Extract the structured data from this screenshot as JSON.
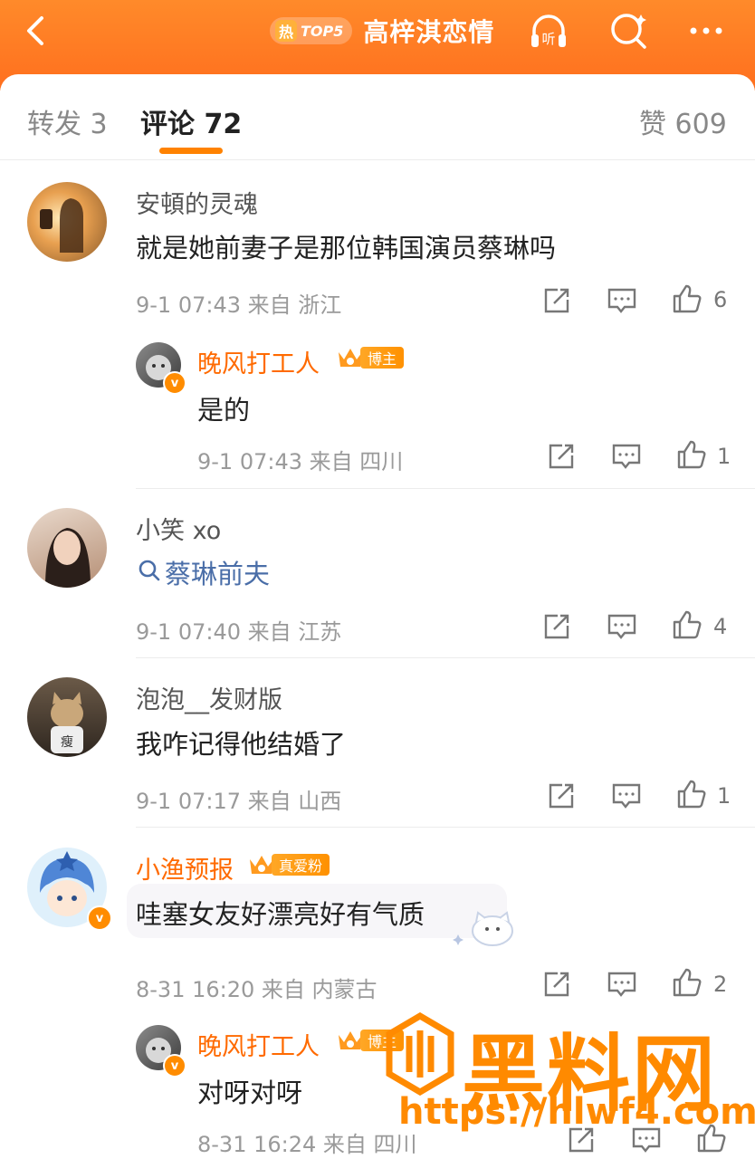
{
  "header": {
    "hot_char": "热",
    "hot_rank": "TOP5",
    "title": "高梓淇恋情",
    "listen_label": "听"
  },
  "tabs": {
    "repost": "转发 3",
    "comments": "评论 72",
    "likes": "赞 609"
  },
  "comments": [
    {
      "user": "安頓的灵魂",
      "text": "就是她前妻子是那位韩国演员蔡琳吗",
      "meta": "9-1 07:43  来自 浙江",
      "likes": "6",
      "reply": {
        "user": "晚风打工人",
        "badge": "博主",
        "text": "是的",
        "meta": "9-1 07:43  来自 四川",
        "likes": "1"
      }
    },
    {
      "user": "小笑 xo",
      "search_text": "蔡琳前夫",
      "meta": "9-1 07:40  来自 江苏",
      "likes": "4"
    },
    {
      "user": "泡泡__发财版",
      "text": "我咋记得他结婚了",
      "meta": "9-1 07:17  来自 山西",
      "likes": "1"
    },
    {
      "user": "小渔预报",
      "badge": "真爱粉",
      "text": "哇塞女友好漂亮好有气质",
      "meta": "8-31 16:20  来自 内蒙古",
      "likes": "2",
      "reply": {
        "user": "晚风打工人",
        "badge": "博主",
        "text": "对呀对呀",
        "meta": "8-31 16:24  来自 四川"
      }
    }
  ],
  "watermark": {
    "text": "黑料网",
    "url": "https://hlwf4.com"
  },
  "colors": {
    "header": "#ff7a22",
    "accent": "#ff8200",
    "link": "#4a6ea8"
  }
}
